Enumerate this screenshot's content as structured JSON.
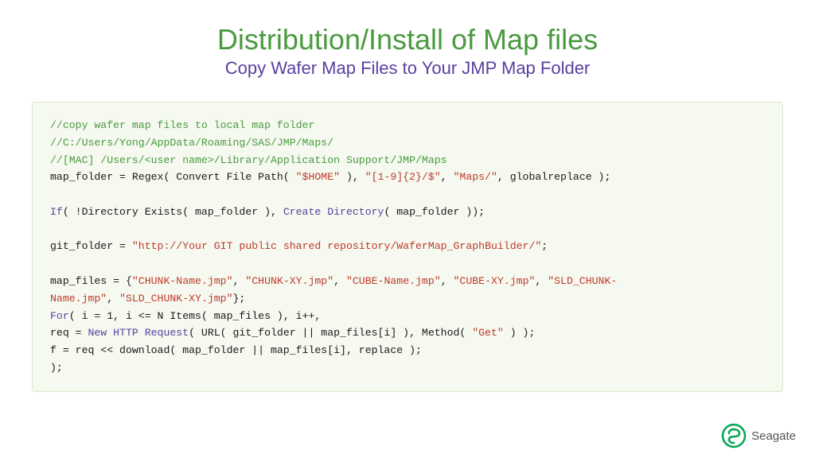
{
  "header": {
    "title_main": "Distribution/Install of Map files",
    "title_sub": "Copy Wafer Map Files to Your JMP Map Folder"
  },
  "code": {
    "line1": "//copy wafer map files to local map folder",
    "line2": "//C:/Users/Yong/AppData/Roaming/SAS/JMP/Maps/",
    "line3": "//[MAC] /Users/<user name>/Library/Application Support/JMP/Maps",
    "line4_normal1": "map_folder = Regex( Convert File Path( ",
    "line4_str1": "\"$HOME\"",
    "line4_normal2": " ), ",
    "line4_str2": "\"[1-9]{2}/$\"",
    "line4_normal3": ", ",
    "line4_str3": "\"Maps/\"",
    "line4_normal4": ", globalreplace );",
    "line5_kw": "If",
    "line5_normal": "( !Directory Exists( map_folder ), ",
    "line5_kw2": "Create Directory",
    "line5_normal2": "( map_folder ));",
    "line6_normal": "git_folder = ",
    "line6_str": "\"http://Your GIT public shared repository/WaferMap_GraphBuilder/\"",
    "line6_end": ";",
    "line7_normal": "map_files = {",
    "line7_str1": "\"CHUNK-Name.jmp\"",
    "line7_normal2": ", ",
    "line7_str2": "\"CHUNK-XY.jmp\"",
    "line7_normal3": ", ",
    "line7_str3": "\"CUBE-Name.jmp\"",
    "line7_normal4": ", ",
    "line7_str4": "\"CUBE-XY.jmp\"",
    "line7_normal5": ", ",
    "line7_str5": "\"SLD_CHUNK-",
    "line8_str1": "Name.jmp\"",
    "line8_normal": ", ",
    "line8_str2": "\"SLD_CHUNK-XY.jmp\"",
    "line8_end": "};",
    "line9_kw": "For",
    "line9_normal": "( i = 1, i <= N ",
    "line9_items": "Items",
    "line9_normal2": "( map_files ), i++,",
    "line10_normal": "        req = ",
    "line10_kw": "New HTTP Request",
    "line10_normal2": "( URL( git_folder || map_files[i] ), Method( ",
    "line10_str": "\"Get\"",
    "line10_end": " ) );",
    "line11_normal": "        f = req << download( map_folder || map_files[i], replace );",
    "line12_end": ");"
  },
  "logo": {
    "text": "Seagate"
  }
}
